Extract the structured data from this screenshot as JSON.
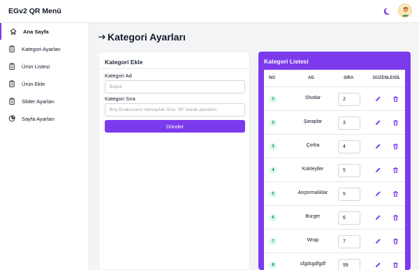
{
  "app": {
    "brand": "EGv2 QR Menü"
  },
  "header": {
    "theme_icon": "moon-icon",
    "avatar_icon": "user-avatar-icon"
  },
  "sidebar": {
    "items": [
      {
        "label": "Ana Sayfa",
        "icon": "home-icon",
        "active": true
      },
      {
        "label": "Kategori Ayarları",
        "icon": "clipboard-icon",
        "active": false
      },
      {
        "label": "Ürün Listesi",
        "icon": "clipboard-icon",
        "active": false
      },
      {
        "label": "Ürün Ekle",
        "icon": "clipboard-icon",
        "active": false
      },
      {
        "label": "Slider Ayarları",
        "icon": "clipboard-icon",
        "active": false
      },
      {
        "label": "Sayfa Ayarları",
        "icon": "pie-chart-icon",
        "active": false
      }
    ]
  },
  "page": {
    "title": "Kategori Ayarları",
    "title_icon": "arrow-right-icon"
  },
  "add_form": {
    "title": "Kategori Ekle",
    "name_label": "Kategori Ad",
    "name_placeholder": "Başlık",
    "order_label": "Kategori Sıra",
    "order_placeholder": "Boş Bırakırsanız Varsayılan Sıra: '99' olarak ayarlanır.",
    "submit_label": "Gönder"
  },
  "category_list": {
    "title": "Kategori Listesi",
    "columns": {
      "no": "NO",
      "name": "AD",
      "order": "SIRA",
      "actions": "DÜZENLE/SİL"
    },
    "rows": [
      {
        "no": "1",
        "name": "Shotlar",
        "order": "2"
      },
      {
        "no": "2",
        "name": "Şaraplar",
        "order": "3"
      },
      {
        "no": "3",
        "name": "Çorba",
        "order": "4"
      },
      {
        "no": "4",
        "name": "Kokteyller",
        "order": "5"
      },
      {
        "no": "5",
        "name": "Atıştırmalıklar",
        "order": "5"
      },
      {
        "no": "6",
        "name": "Burger",
        "order": "6"
      },
      {
        "no": "7",
        "name": "Wrap",
        "order": "7"
      },
      {
        "no": "8",
        "name": "sfgdsgdfgdf",
        "order": "99"
      }
    ]
  },
  "colors": {
    "accent": "#7c3aed",
    "badge_bg": "#d1fae5",
    "badge_text": "#047857"
  }
}
